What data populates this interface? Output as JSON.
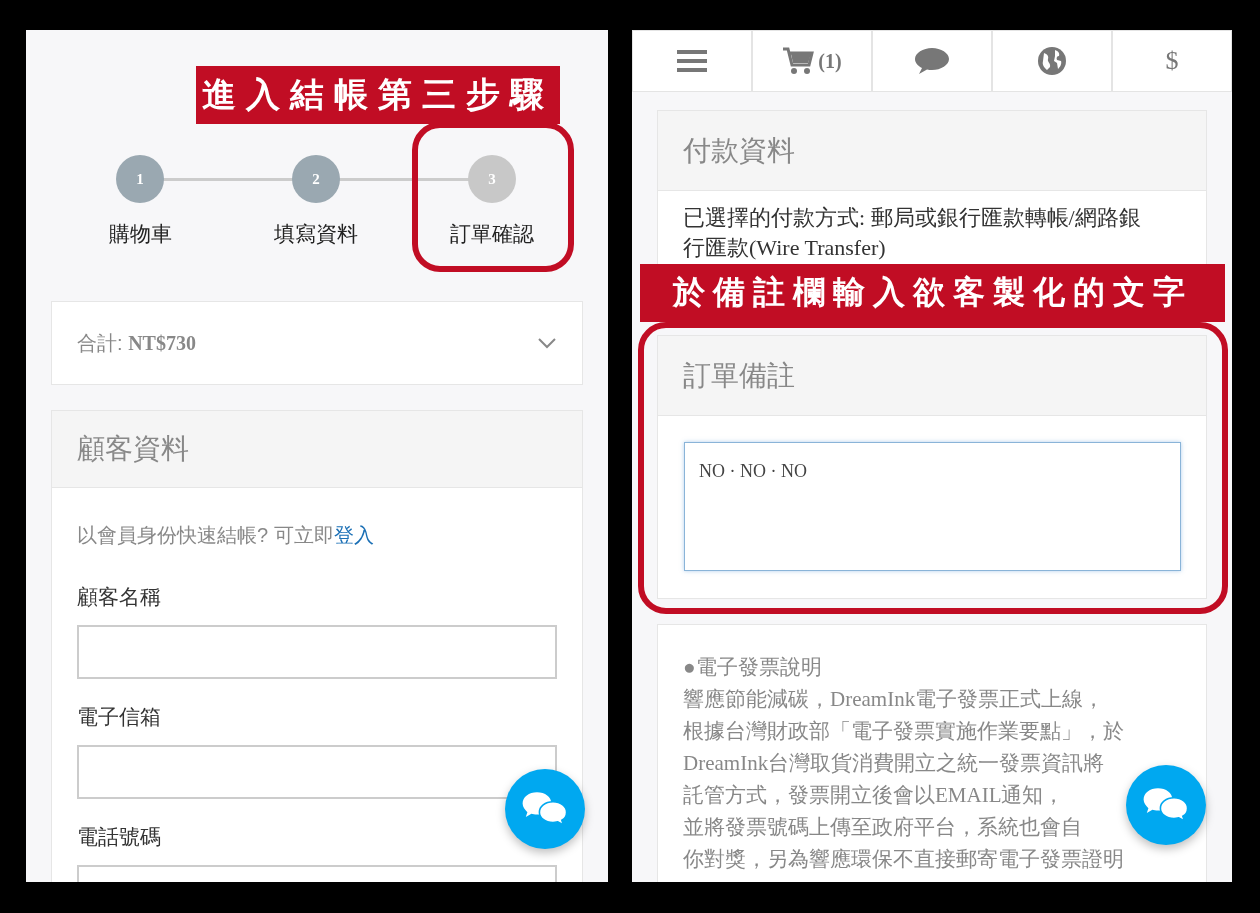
{
  "left_screen": {
    "annotation": "進入結帳第三步驟",
    "steps": [
      {
        "number": "1",
        "label": "購物車",
        "completed": true
      },
      {
        "number": "2",
        "label": "填寫資料",
        "completed": true
      },
      {
        "number": "3",
        "label": "訂單確認",
        "completed": false
      }
    ],
    "summary": {
      "label": "合計:",
      "amount": "NT$730",
      "expanded": false
    },
    "customer_card": {
      "title": "顧客資料",
      "prompt": "以會員身份快速結帳? 可立即",
      "login_link": "登入",
      "fields": [
        {
          "label": "顧客名稱"
        },
        {
          "label": "電子信箱"
        },
        {
          "label": "電話號碼"
        }
      ]
    }
  },
  "right_screen": {
    "nav": [
      {
        "kind": "menu"
      },
      {
        "kind": "cart",
        "text": "(1)"
      },
      {
        "kind": "chat"
      },
      {
        "kind": "globe"
      },
      {
        "kind": "text",
        "text": "$"
      }
    ],
    "payment_card": {
      "title": "付款資料",
      "text": "已選擇的付款方式: 郵局或銀行匯款轉帳/網路銀行匯款(Wire Transfer)"
    },
    "annotation": "於備註欄輸入欲客製化的文字",
    "notes_card": {
      "title": "訂單備註",
      "value": "NO · NO · NO"
    },
    "invoice_card": {
      "lines": [
        "●電子發票說明",
        "響應節能減碳，DreamInk電子發票正式上線，",
        "根據台灣財政部「電子發票實施作業要點」，於",
        "DreamInk台灣取貨消費開立之統一發票資訊將",
        "託管方式，發票開立後會以EMAIL通知，",
        "並將發票號碼上傳至政府平台，系統也會自",
        "你對獎，另為響應環保不直接郵寄電子發票證明"
      ]
    }
  }
}
